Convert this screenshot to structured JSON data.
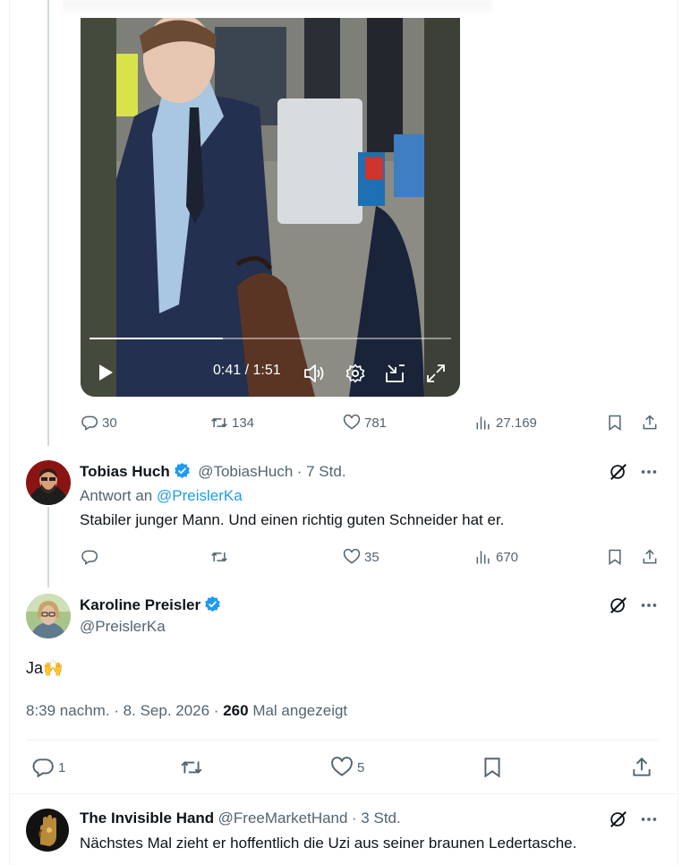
{
  "video": {
    "current_time": "0:41",
    "separator": " / ",
    "duration": "1:51",
    "progress": 0.37
  },
  "main_tweet_stats": {
    "replies": "30",
    "retweets": "134",
    "likes": "781",
    "views": "27.169"
  },
  "reply1": {
    "name": "Tobias Huch",
    "handle": "@TobiasHuch",
    "time": "· 7 Std.",
    "reply_prefix": "Antwort an",
    "reply_to": "@PreislerKa",
    "text": "Stabiler junger Mann. Und einen richtig guten Schneider hat er.",
    "replies": "",
    "retweets": "",
    "likes": "35",
    "views": "670"
  },
  "focus_tweet": {
    "name": "Karoline Preisler",
    "handle": "@PreislerKa",
    "text": "Ja",
    "emoji": "🙌",
    "timestamp": "8:39 nachm. · 8. Sep. 2026 ·",
    "view_count": "260",
    "view_label": "Mal angezeigt",
    "replies": "1",
    "likes": "5"
  },
  "reply2": {
    "name": "The Invisible Hand",
    "handle": "@FreeMarketHand",
    "time": "· 3 Std.",
    "text": "Nächstes Mal zieht er hoffentlich die Uzi aus seiner braunen Ledertasche."
  },
  "colors": {
    "accent": "#1d9bf0",
    "secondary_text": "#536471",
    "border": "#eff3f4"
  }
}
